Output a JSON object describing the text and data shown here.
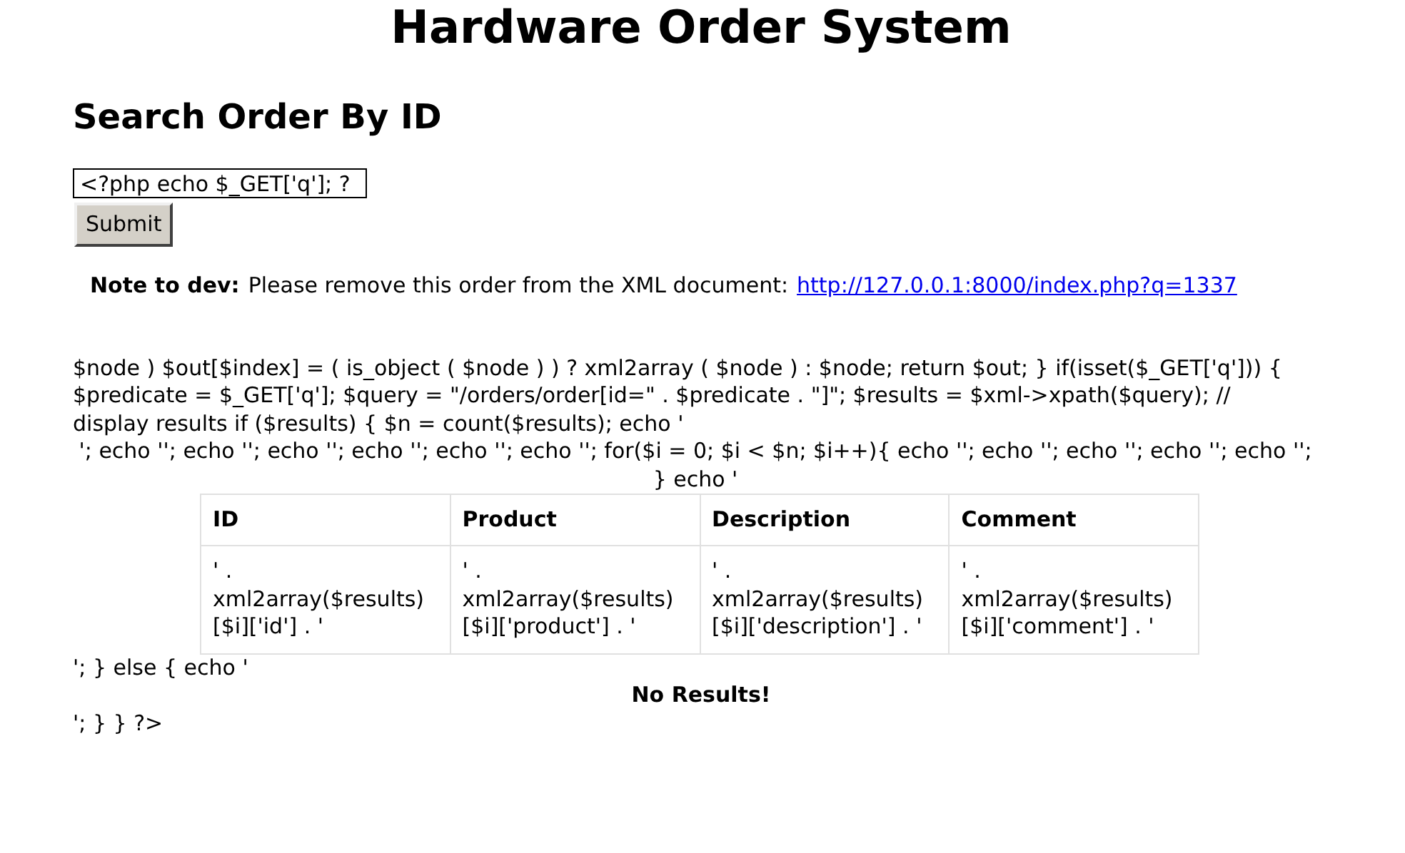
{
  "page_title": "Hardware Order System",
  "search": {
    "heading": "Search Order By ID",
    "value": "<?php echo $_GET['q']; ?",
    "button": "Submit"
  },
  "note": {
    "label": "Note to dev:",
    "text": "Please remove this order from the XML document:",
    "link": "http://127.0.0.1:8000/index.php?q=1337"
  },
  "code_text": "$node ) $out[$index] = ( is_object ( $node ) ) ? xml2array ( $node ) : $node; return $out; } if(isset($_GET['q'])) { $predicate = $_GET['q']; $query = \"/orders/order[id=\" . $predicate . \"]\"; $results = $xml->xpath($query); // display results if ($results) { $n = count($results); echo '",
  "code_text_centered": "'; echo ''; echo ''; echo ''; echo ''; echo ''; echo ''; for($i = 0; $i < $n; $i++){ echo ''; echo ''; echo ''; echo ''; echo ''; } echo '",
  "table": {
    "columns": [
      "ID",
      "Product",
      "Description",
      "Comment"
    ],
    "rows": [
      [
        "' . xml2array($results)[$i]['id'] . '",
        "' . xml2array($results)[$i]['product'] . '",
        "' . xml2array($results)[$i]['description'] . '",
        "' . xml2array($results)[$i]['comment'] . '"
      ]
    ]
  },
  "else_text": "'; } else { echo '",
  "no_results": "No Results!",
  "end_text": "'; } } ?>"
}
